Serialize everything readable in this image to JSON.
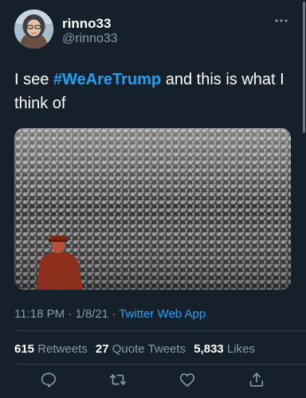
{
  "user": {
    "display_name": "rinno33",
    "handle": "@rinno33"
  },
  "tweet": {
    "text_before": "I see ",
    "hashtag": "#WeAreTrump",
    "text_after": " and this is what I think of"
  },
  "meta": {
    "time": "11:18 PM",
    "separator1": " · ",
    "date": "1/8/21",
    "separator2": " · ",
    "source": "Twitter Web App"
  },
  "stats": {
    "retweets_count": "615",
    "retweets_label": "Retweets",
    "quotes_count": "27",
    "quotes_label": "Quote Tweets",
    "likes_count": "5,833",
    "likes_label": "Likes"
  },
  "icons": {
    "more": "more-horizontal-icon",
    "reply": "reply-icon",
    "retweet": "retweet-icon",
    "like": "heart-icon",
    "share": "share-icon"
  },
  "colors": {
    "background": "#15202b",
    "accent": "#1da1f2",
    "secondary_text": "#8899a6",
    "divider": "#38444d"
  }
}
